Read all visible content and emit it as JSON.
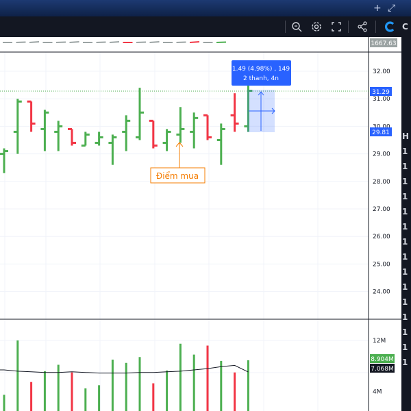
{
  "toolbar": {
    "top_plus": "+",
    "top_expand": "⤢",
    "icons": [
      "search-alert-icon",
      "gear-icon",
      "fullscreen-icon",
      "share-icon",
      "logo-icon"
    ]
  },
  "right_panel": {
    "glyphs": [
      "C",
      "H",
      "1",
      "1",
      "1",
      "1",
      "1",
      "1",
      "1",
      "1",
      "1",
      "1",
      "1",
      "1",
      "1",
      "1",
      "1"
    ]
  },
  "compare": {
    "value_label": "1667.63"
  },
  "annotations": {
    "measure_line1": "1.49 (4.98%) , 149",
    "measure_line2": "2 thanh, 4n",
    "callout": "Điểm mua"
  },
  "price_axis": {
    "ticks": [
      "32.00",
      "31.00",
      "30.00",
      "29.00",
      "28.00",
      "27.00",
      "26.00",
      "25.00",
      "24.00"
    ],
    "last_price_label": "31.29",
    "measure_low_label": "29.81"
  },
  "volume_axis": {
    "ticks": [
      "12M",
      "4M"
    ],
    "volume_label": "8.904M",
    "ma_label": "7.068M"
  },
  "colors": {
    "up": "#4caf50",
    "down": "#f23645",
    "accent": "#2962ff",
    "callout": "#f57c00"
  },
  "chart_data": {
    "type": "ohlc",
    "price_scale": {
      "ylim": [
        23.4,
        32.7
      ],
      "ticks": [
        32,
        31,
        30,
        29,
        28,
        27,
        26,
        25,
        24
      ]
    },
    "volume_scale": {
      "ylim": [
        0,
        14
      ],
      "unit": "M",
      "ticks": [
        12,
        4
      ]
    },
    "bars": [
      {
        "o": 29.0,
        "h": 29.2,
        "l": 28.3,
        "c": 29.1,
        "v": 3.5,
        "up": true
      },
      {
        "o": 29.8,
        "h": 31.0,
        "l": 29.0,
        "c": 30.9,
        "v": 12.0,
        "up": true
      },
      {
        "o": 30.9,
        "h": 30.9,
        "l": 29.8,
        "c": 30.1,
        "v": 5.5,
        "up": false
      },
      {
        "o": 29.9,
        "h": 30.6,
        "l": 29.1,
        "c": 30.5,
        "v": 7.2,
        "up": true
      },
      {
        "o": 29.8,
        "h": 30.2,
        "l": 29.1,
        "c": 30.0,
        "v": 8.2,
        "up": true
      },
      {
        "o": 29.9,
        "h": 29.9,
        "l": 29.3,
        "c": 29.4,
        "v": 7.0,
        "up": false
      },
      {
        "o": 29.3,
        "h": 29.8,
        "l": 29.3,
        "c": 29.7,
        "v": 4.5,
        "up": true
      },
      {
        "o": 29.4,
        "h": 29.8,
        "l": 29.3,
        "c": 29.6,
        "v": 5.0,
        "up": true
      },
      {
        "o": 29.4,
        "h": 29.7,
        "l": 28.6,
        "c": 29.6,
        "v": 9.0,
        "up": true
      },
      {
        "o": 29.8,
        "h": 30.4,
        "l": 29.1,
        "c": 30.2,
        "v": 8.5,
        "up": true
      },
      {
        "o": 29.6,
        "h": 31.4,
        "l": 29.5,
        "c": 30.5,
        "v": 9.4,
        "up": true
      },
      {
        "o": 30.2,
        "h": 30.2,
        "l": 29.2,
        "c": 29.3,
        "v": 5.3,
        "up": false
      },
      {
        "o": 29.4,
        "h": 29.9,
        "l": 29.1,
        "c": 29.8,
        "v": 7.3,
        "up": true
      },
      {
        "o": 29.7,
        "h": 30.7,
        "l": 29.4,
        "c": 29.9,
        "v": 11.5,
        "up": true
      },
      {
        "o": 29.8,
        "h": 30.5,
        "l": 29.2,
        "c": 30.3,
        "v": 9.8,
        "up": true
      },
      {
        "o": 30.4,
        "h": 30.4,
        "l": 29.5,
        "c": 29.6,
        "v": 11.2,
        "up": false
      },
      {
        "o": 29.5,
        "h": 30.1,
        "l": 28.6,
        "c": 29.9,
        "v": 8.8,
        "up": true
      },
      {
        "o": 30.4,
        "h": 31.2,
        "l": 29.8,
        "c": 30.1,
        "v": 7.0,
        "up": false
      },
      {
        "o": 30.0,
        "h": 31.7,
        "l": 29.8,
        "c": 31.29,
        "v": 8.904,
        "up": true
      }
    ],
    "volume_ma": [
      7.4,
      7.2,
      7.1,
      7.0,
      7.0,
      7.1,
      7.0,
      6.9,
      6.9,
      6.9,
      7.0,
      7.0,
      7.1,
      7.2,
      7.4,
      7.6,
      7.9,
      8.1,
      7.068
    ]
  }
}
